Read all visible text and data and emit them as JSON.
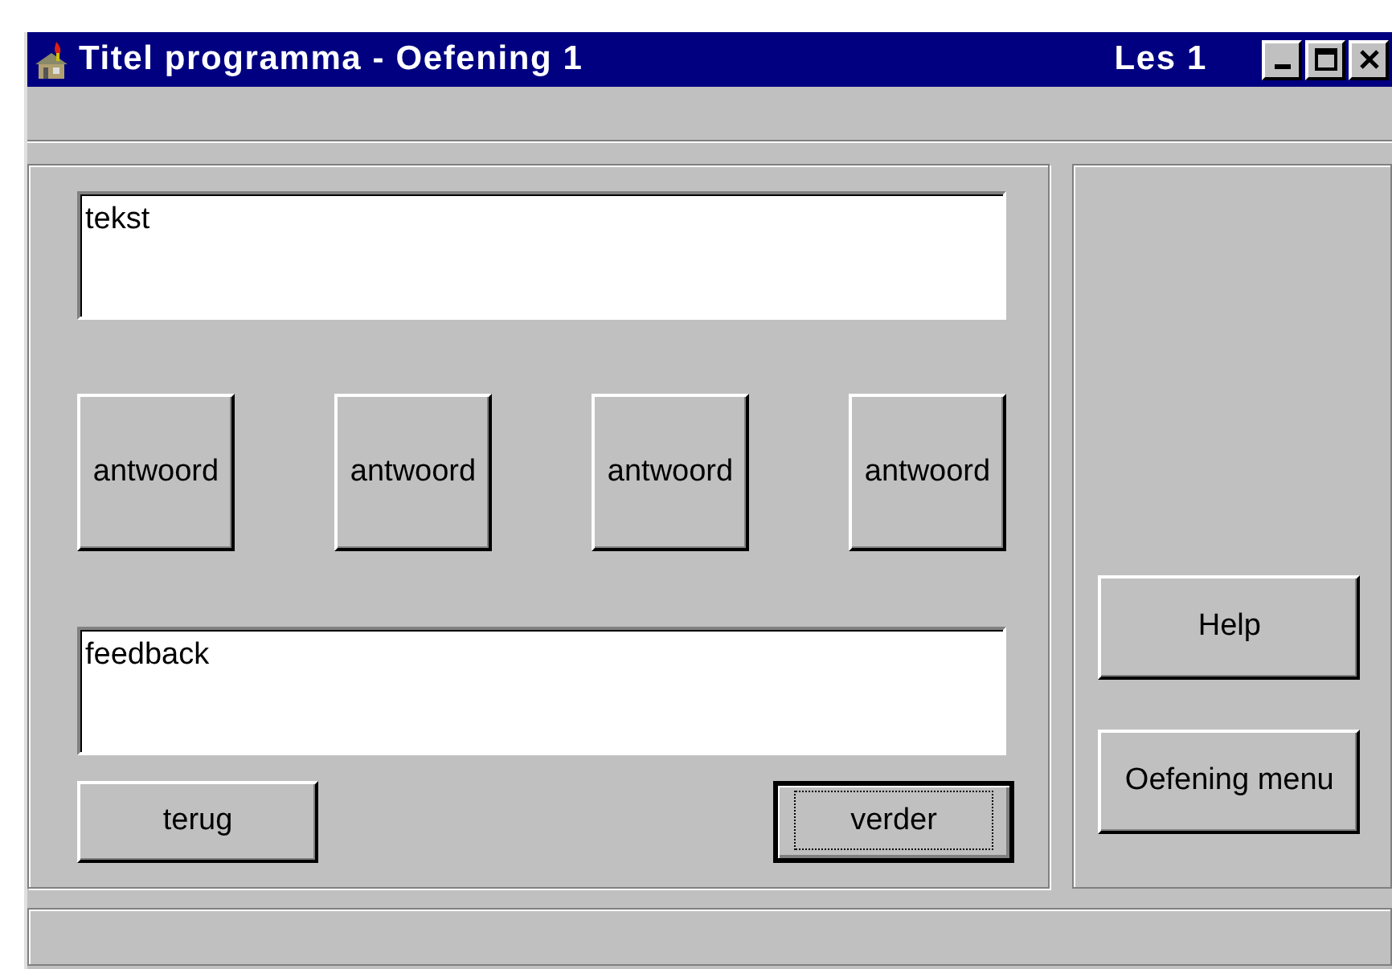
{
  "window": {
    "title": "Titel programma - Oefening 1",
    "lesson": "Les 1"
  },
  "question_box": {
    "text": "tekst"
  },
  "answers": [
    {
      "label": "antwoord"
    },
    {
      "label": "antwoord"
    },
    {
      "label": "antwoord"
    },
    {
      "label": "antwoord"
    }
  ],
  "feedback_box": {
    "text": "feedback"
  },
  "nav_buttons": [
    {
      "label": "terug",
      "focused": false
    },
    {
      "label": "verder",
      "focused": true
    }
  ],
  "side_buttons": [
    {
      "label": "Help"
    },
    {
      "label": "Oefening menu"
    }
  ]
}
